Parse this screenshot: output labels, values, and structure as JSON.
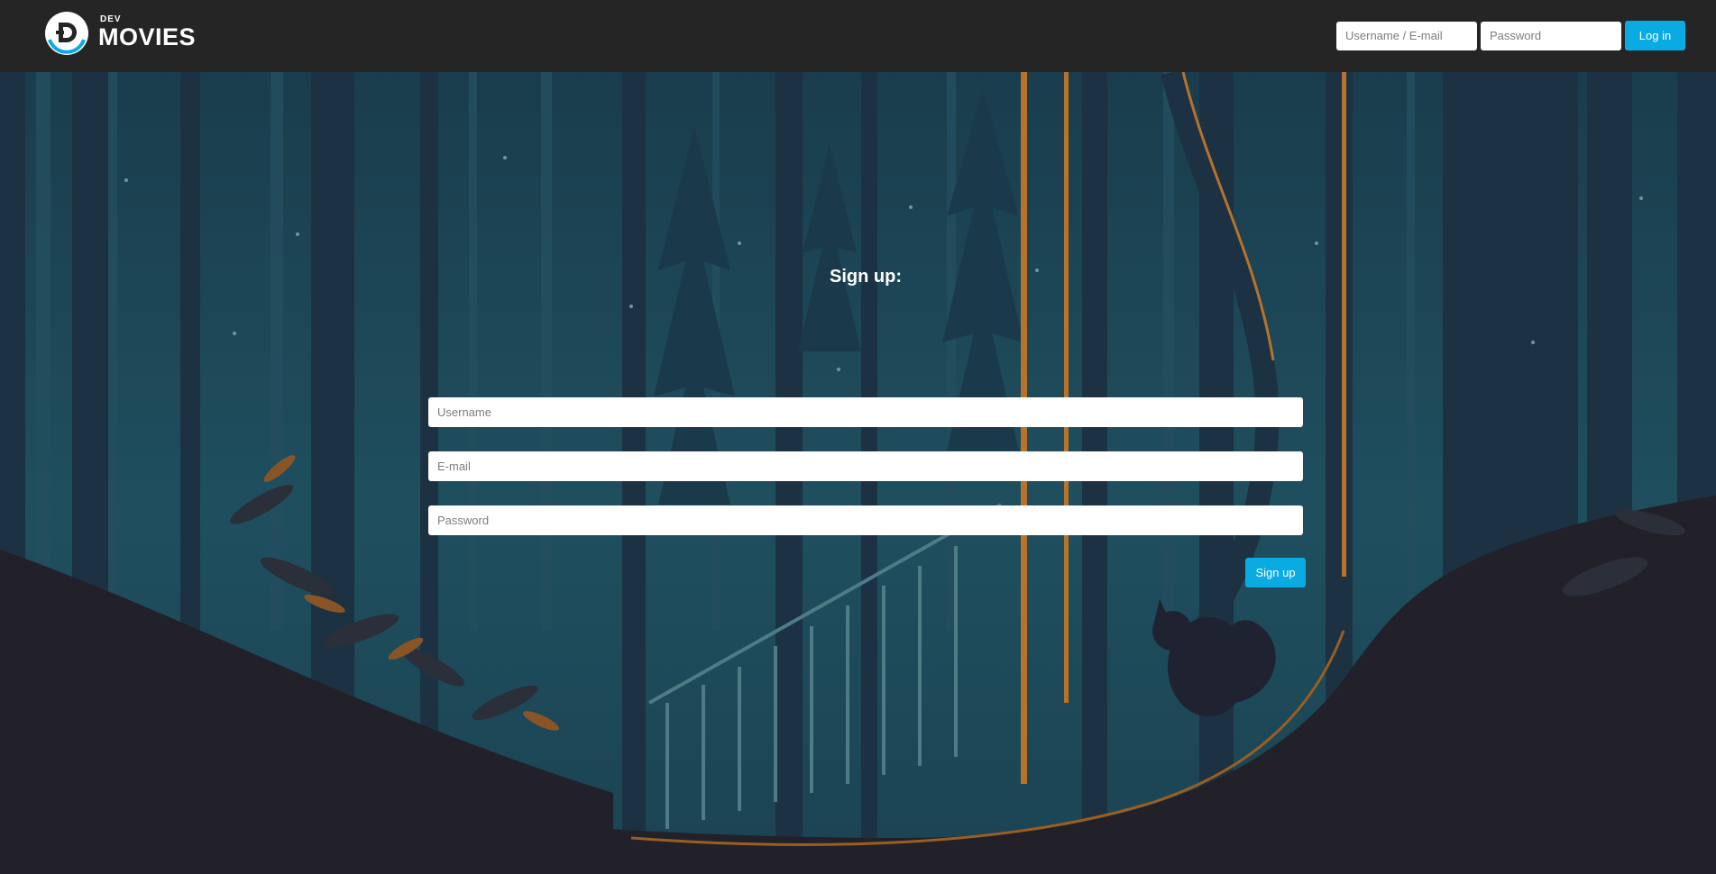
{
  "header": {
    "logo": {
      "small_text": "DEV",
      "large_text": "MOVIES",
      "icon": "logo-d-icon"
    },
    "login": {
      "username_placeholder": "Username / E-mail",
      "password_placeholder": "Password",
      "login_label": "Log in"
    }
  },
  "signup": {
    "title": "Sign up:",
    "username_placeholder": "Username",
    "email_placeholder": "E-mail",
    "password_placeholder": "Password",
    "submit_label": "Sign up"
  },
  "colors": {
    "accent": "#0aaae3",
    "header_bg": "#252525",
    "forest_teal": "#1d4a5a",
    "ground": "#22212a",
    "orange_highlight": "#b8722a"
  }
}
